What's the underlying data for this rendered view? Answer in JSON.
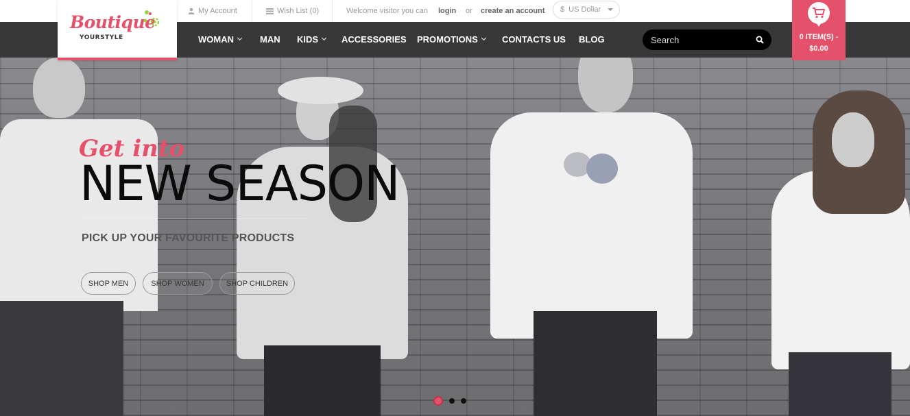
{
  "topbar": {
    "my_account": "My Account",
    "wish_list": "Wish List (0)",
    "welcome": "Welcome visitor you can",
    "login": "login",
    "or": "or",
    "create_account": "create an account",
    "currency_symbol": "$",
    "currency": "US Dollar"
  },
  "logo": {
    "brand": "Boutique",
    "tagline": "YOURSTYLE"
  },
  "nav": {
    "items": [
      {
        "label": "WOMAN",
        "has_dropdown": true
      },
      {
        "label": "MAN",
        "has_dropdown": false
      },
      {
        "label": "KIDS",
        "has_dropdown": true
      },
      {
        "label": "ACCESSORIES",
        "has_dropdown": false
      },
      {
        "label": "PROMOTIONS",
        "has_dropdown": true
      },
      {
        "label": "CONTACTS US",
        "has_dropdown": false
      },
      {
        "label": "BLOG",
        "has_dropdown": false
      }
    ]
  },
  "search": {
    "placeholder": "Search"
  },
  "cart": {
    "items": "0 ITEM(S) -",
    "total": "$0.00"
  },
  "hero": {
    "kicker": "Get into",
    "title": "NEW SEASON",
    "subtitle": "PICK UP YOUR FAVOURITE PRODUCTS",
    "buttons": [
      "SHOP MEN",
      "SHOP WOMEN",
      "SHOP CHILDREN"
    ]
  },
  "slider": {
    "slide_count": 3,
    "active_index": 0
  },
  "colors": {
    "accent": "#e5506b",
    "nav_bg": "#1c1c1c",
    "search_bg": "#000000"
  }
}
